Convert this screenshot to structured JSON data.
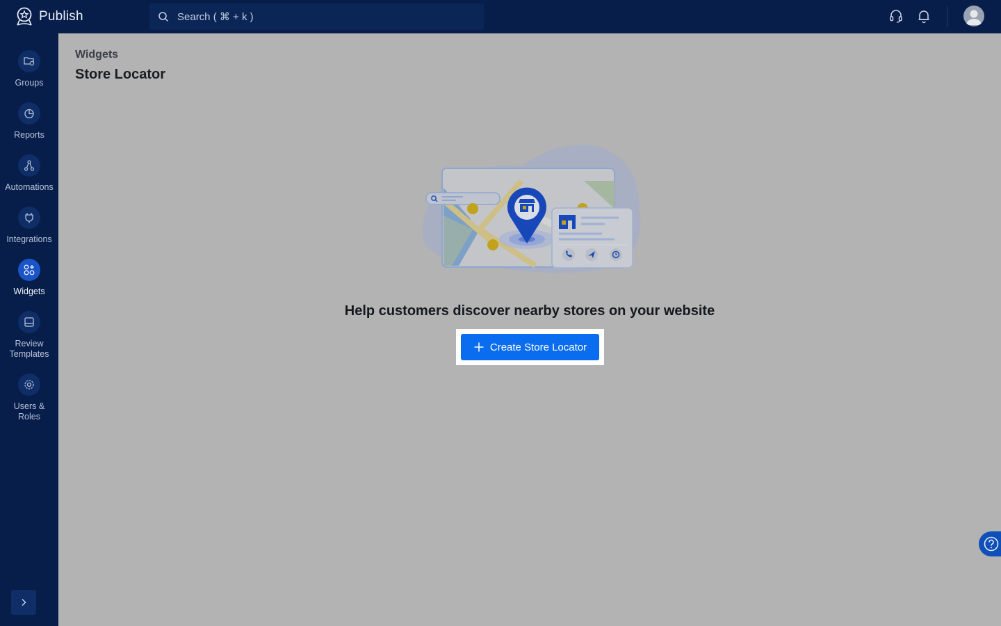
{
  "app": {
    "name": "Publish"
  },
  "search": {
    "placeholder": "Search ( ⌘ + k )"
  },
  "topbar": {
    "icons": [
      "headset-icon",
      "bell-icon",
      "avatar"
    ]
  },
  "sidebar": {
    "items": [
      {
        "label": "Groups",
        "icon": "folder-location-icon",
        "active": false
      },
      {
        "label": "Reports",
        "icon": "pie-chart-icon",
        "active": false
      },
      {
        "label": "Automations",
        "icon": "workflow-icon",
        "active": false
      },
      {
        "label": "Integrations",
        "icon": "plug-icon",
        "active": false
      },
      {
        "label": "Widgets",
        "icon": "widgets-icon",
        "active": true
      },
      {
        "label": "Review Templates",
        "icon": "template-icon",
        "active": false
      },
      {
        "label": "Users & Roles",
        "icon": "gear-icon",
        "active": false
      }
    ],
    "expand_icon": "chevron-right-icon"
  },
  "page": {
    "breadcrumb": "Widgets",
    "title": "Store Locator",
    "empty_heading": "Help customers discover nearby stores on your website",
    "cta_label": "Create Store Locator"
  },
  "colors": {
    "sidebar_bg": "#071e4a",
    "accent": "#0a6df0",
    "overlay_bg": "#b3b3b3"
  }
}
